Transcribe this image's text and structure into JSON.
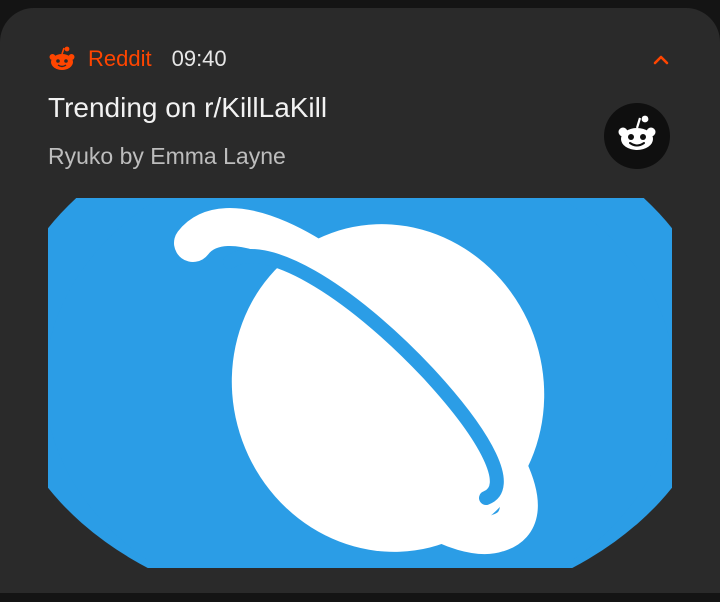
{
  "notification": {
    "app_name": "Reddit",
    "time": "09:40",
    "title": "Trending on r/KillLaKill",
    "subtitle": "Ryuko by Emma Layne",
    "accent_color": "#ff4500",
    "app_icon": "reddit-alien-icon",
    "expand_icon": "chevron-up-icon",
    "avatar_icon": "reddit-alien-icon",
    "image": {
      "description_icon": "planet-icon",
      "background_color": "#2b9de6"
    }
  }
}
